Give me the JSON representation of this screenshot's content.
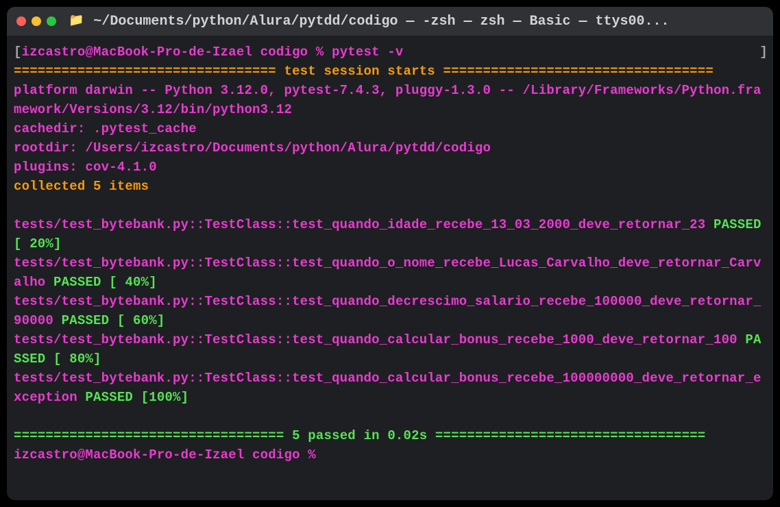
{
  "window": {
    "title": "~/Documents/python/Alura/pytdd/codigo — -zsh — zsh — Basic — ttys00..."
  },
  "prompt": {
    "open_bracket": "[",
    "user_host": "izcastro@MacBook-Pro-de-Izael codigo % ",
    "command": "pytest -v",
    "close_bracket": "]"
  },
  "session": {
    "rule_left": "================================= ",
    "header": "test session starts",
    "rule_right": " =================================="
  },
  "env": {
    "platform": "platform darwin -- Python 3.12.0, pytest-7.4.3, pluggy-1.3.0 -- /Library/Frameworks/Python.framework/Versions/3.12/bin/python3.12",
    "cachedir": "cachedir: .pytest_cache",
    "rootdir": "rootdir: /Users/izcastro/Documents/python/Alura/pytdd/codigo",
    "plugins": "plugins: cov-4.1.0"
  },
  "collected": "collected 5 items",
  "tests": [
    {
      "path": "tests/test_bytebank.py::TestClass::test_quando_idade_recebe_13_03_2000_deve_retornar_23 ",
      "status": "PASSED",
      "pct": " [ 20%]"
    },
    {
      "path": "tests/test_bytebank.py::TestClass::test_quando_o_nome_recebe_Lucas_Carvalho_deve_retornar_Carvalho ",
      "status": "PASSED",
      "pct": " [ 40%]"
    },
    {
      "path": "tests/test_bytebank.py::TestClass::test_quando_decrescimo_salario_recebe_100000_deve_retornar_90000 ",
      "status": "PASSED",
      "pct": " [ 60%]"
    },
    {
      "path": "tests/test_bytebank.py::TestClass::test_quando_calcular_bonus_recebe_1000_deve_retornar_100 ",
      "status": "PASSED",
      "pct": " [ 80%]"
    },
    {
      "path": "tests/test_bytebank.py::TestClass::test_quando_calcular_bonus_recebe_100000000_deve_retornar_exception ",
      "status": "PASSED",
      "pct": " [100%]"
    }
  ],
  "summary": {
    "rule_left": "================================== ",
    "passed": "5 passed",
    "timing": " in 0.02s",
    "rule_right": " =================================="
  },
  "prompt2": {
    "user_host": "izcastro@MacBook-Pro-de-Izael codigo % "
  }
}
